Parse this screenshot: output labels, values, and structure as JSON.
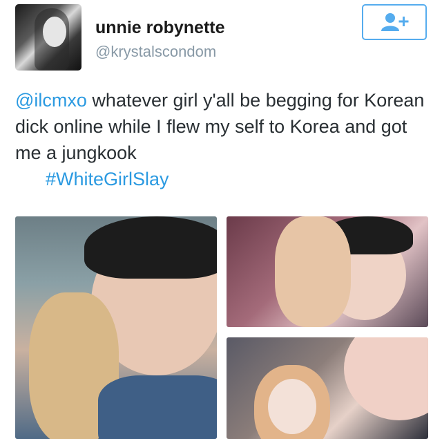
{
  "tweet": {
    "display_name": "unnie robynette",
    "handle": "@krystalscondom",
    "text": {
      "mention": "@ilcmxo",
      "body": " whatever girl y'all be begging for Korean dick online while I flew my self to Korea and got me a jungkook",
      "hashtag": "#WhiteGirlSlay"
    }
  },
  "icons": {
    "follow": "add-user-icon",
    "avatar": "profile-photo"
  },
  "colors": {
    "accent": "#55acee",
    "link": "#2b9ae1",
    "text": "#292f33",
    "secondary": "#8899a6"
  }
}
